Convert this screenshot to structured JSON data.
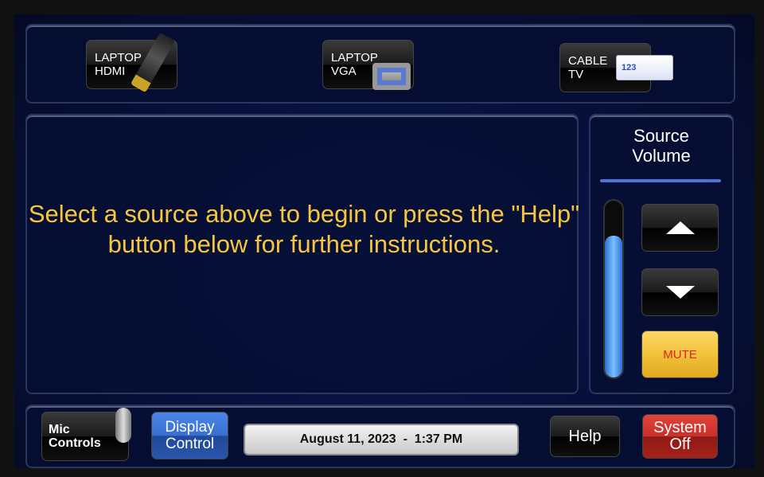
{
  "sources": [
    {
      "label": "LAPTOP\nHDMI",
      "icon": "hdmi-cable-icon"
    },
    {
      "label": "LAPTOP\nVGA",
      "icon": "vga-cable-icon"
    },
    {
      "label": "CABLE\nTV",
      "icon": "cable-box-icon"
    }
  ],
  "cable_icon_text": "123",
  "message": "Select a source above to begin or press the \"Help\" button below for further instructions.",
  "volume": {
    "title": "Source\nVolume",
    "level_percent": 80,
    "mute_label": "MUTE",
    "accent": "#4a74d8"
  },
  "footer": {
    "mic_label": "Mic\nControls",
    "display_label": "Display\nControl",
    "datetime": "August 11, 2023  -  1:37 PM",
    "help_label": "Help",
    "off_label": "System\nOff"
  },
  "colors": {
    "message": "#f7c63c",
    "mute": "#f2c23a",
    "system_off": "#b8231c",
    "display": "#2d5fb8"
  }
}
